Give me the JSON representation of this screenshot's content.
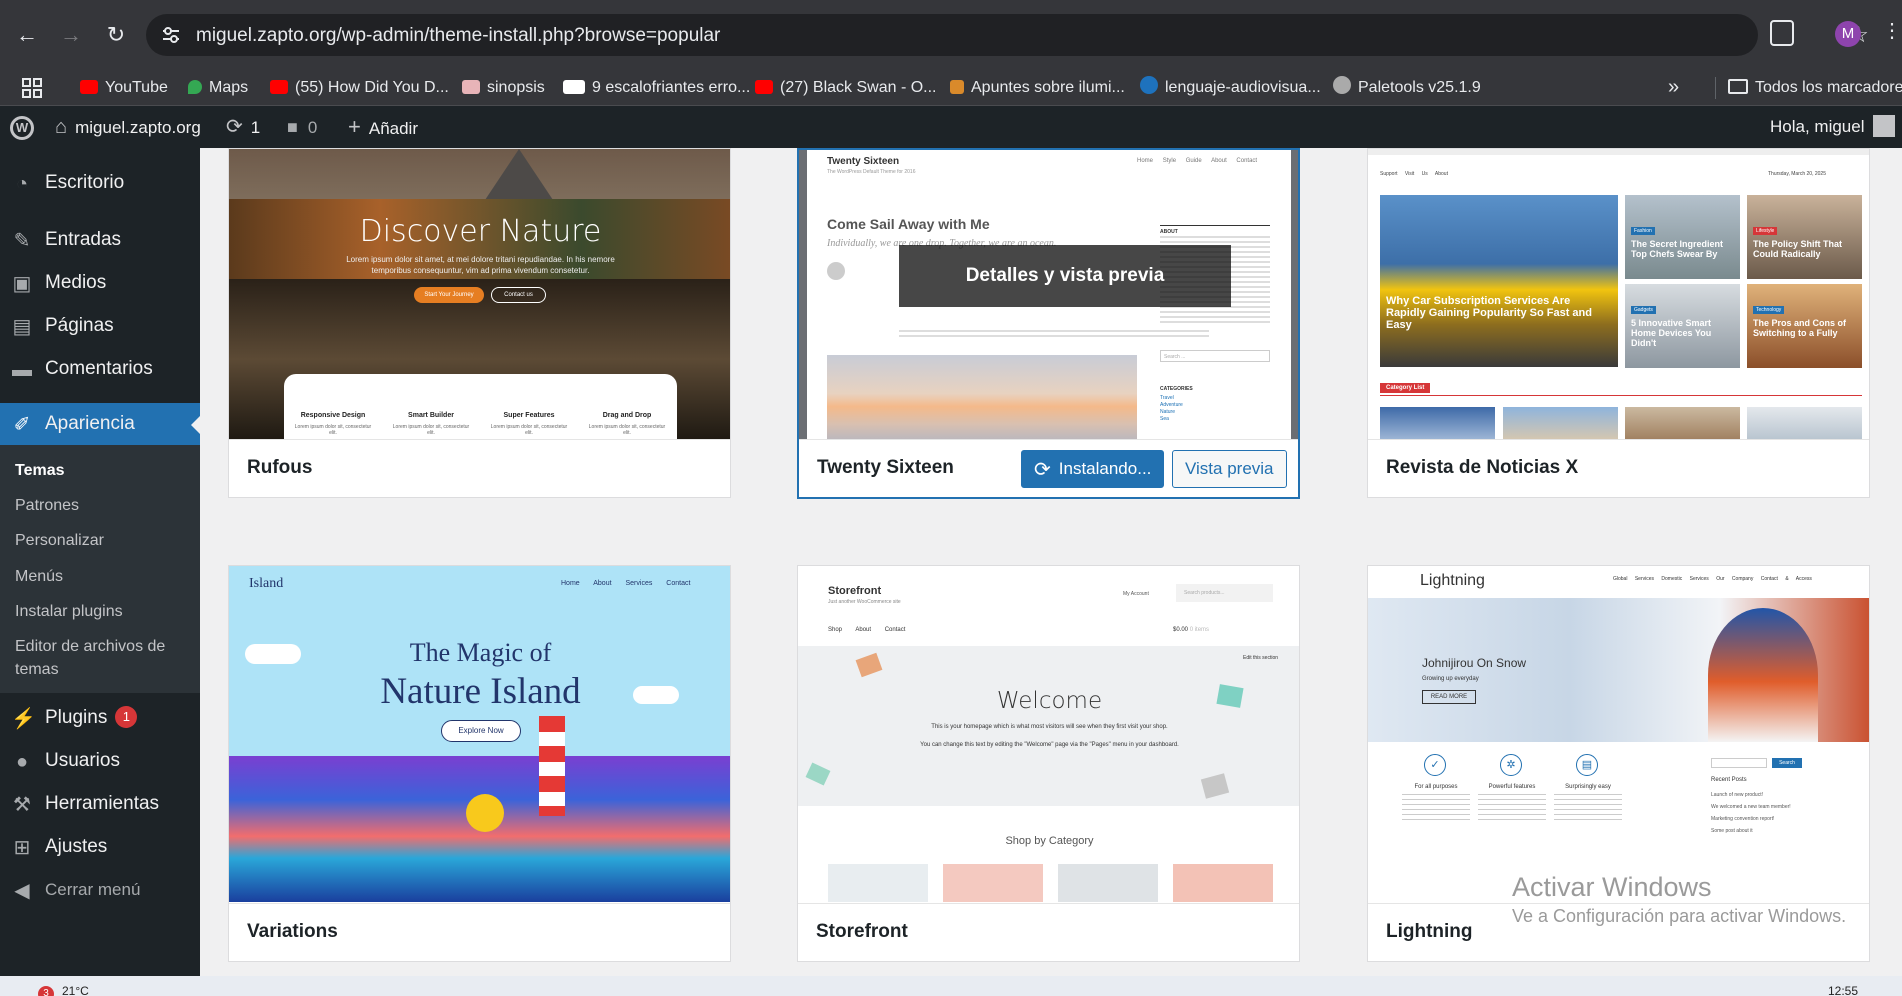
{
  "browser": {
    "url": "miguel.zapto.org/wp-admin/theme-install.php?browse=popular",
    "profile_initial": "M",
    "bookmarks": [
      {
        "label": "YouTube",
        "icon": "youtube-icon"
      },
      {
        "label": "Maps",
        "icon": "maps-icon"
      },
      {
        "label": "(55) How Did You D...",
        "icon": "youtube-icon"
      },
      {
        "label": "sinopsis",
        "icon": "bookmark-icon"
      },
      {
        "label": "9 escalofriantes erro...",
        "icon": "ed-icon"
      },
      {
        "label": "(27) Black Swan - O...",
        "icon": "youtube-icon"
      },
      {
        "label": "Apuntes sobre ilumi...",
        "icon": "person-icon"
      },
      {
        "label": "lenguaje-audiovisua...",
        "icon": "wordpress-icon"
      },
      {
        "label": "Paletools v25.1.9",
        "icon": "globe-icon"
      }
    ],
    "more_label": "»",
    "all_bookmarks": "Todos los marcadores"
  },
  "adminbar": {
    "site": "miguel.zapto.org",
    "updates": "1",
    "comments": "0",
    "new": "Añadir",
    "greeting": "Hola, miguel"
  },
  "sidebar": {
    "items": [
      {
        "label": "Escritorio",
        "icon": "dashboard-icon"
      },
      {
        "label": "Entradas",
        "icon": "pin-icon"
      },
      {
        "label": "Medios",
        "icon": "media-icon"
      },
      {
        "label": "Páginas",
        "icon": "page-icon"
      },
      {
        "label": "Comentarios",
        "icon": "comment-icon"
      },
      {
        "label": "Apariencia",
        "icon": "brush-icon"
      },
      {
        "label": "Plugins",
        "icon": "plugin-icon",
        "badge": "1"
      },
      {
        "label": "Usuarios",
        "icon": "user-icon"
      },
      {
        "label": "Herramientas",
        "icon": "wrench-icon"
      },
      {
        "label": "Ajustes",
        "icon": "settings-icon"
      },
      {
        "label": "Cerrar menú",
        "icon": "collapse-icon"
      }
    ],
    "submenu": [
      "Temas",
      "Patrones",
      "Personalizar",
      "Menús",
      "Instalar plugins",
      "Editor de archivos de temas"
    ]
  },
  "themes": {
    "rufous": {
      "name": "Rufous",
      "hero_title": "Discover Nature",
      "hero_text": "Lorem ipsum dolor sit amet, at mei dolore tritani repudiandae. In his nemore temporibus consequuntur, vim ad prima vivendum consetetur.",
      "btn1": "Start Your Journey",
      "btn2": "Contact us",
      "features": [
        "Responsive Design",
        "Smart Builder",
        "Super Features",
        "Drag and Drop"
      ],
      "feature_text": "Lorem ipsum dolor sit, consectetur elit."
    },
    "twentysixteen": {
      "name": "Twenty Sixteen",
      "site_title": "Twenty Sixteen",
      "tagline": "The WordPress Default Theme for 2016",
      "nav": [
        "Home",
        "Style Guide",
        "About",
        "Contact"
      ],
      "post_title": "Come Sail Away with Me",
      "post_excerpt": "Individually, we are one drop. Together, we are an ocean.",
      "overlay": "Detalles y vista previa",
      "installing": "Instalando...",
      "preview": "Vista previa",
      "about_label": "ABOUT",
      "categories_label": "CATEGORIES",
      "categories": [
        "Travel",
        "Adventure",
        "Nature",
        "Sea"
      ],
      "search_placeholder": "Search ..."
    },
    "revista": {
      "name": "Revista de Noticias X",
      "nav": [
        "Support",
        "Visit Us",
        "About"
      ],
      "date": "Thursday, March 20, 2025",
      "tag_list": "Category List",
      "main_headline": "Why Car Subscription Services Are Rapidly Gaining Popularity So Fast and Easy",
      "cards": [
        {
          "tag": "Fashion",
          "title": "The Secret Ingredient Top Chefs Swear By"
        },
        {
          "tag": "Lifestyle",
          "title": "The Policy Shift That Could Radically"
        },
        {
          "tag": "Gadgets",
          "title": "5 Innovative Smart Home Devices You Didn't"
        },
        {
          "tag": "Technology",
          "title": "The Pros and Cons of Switching to a Fully"
        }
      ]
    },
    "variations": {
      "name": "Variations",
      "brand": "Island",
      "nav": [
        "Home",
        "About",
        "Services",
        "Contact"
      ],
      "line1": "The Magic of",
      "line2": "Nature Island",
      "cta": "Explore Now"
    },
    "storefront": {
      "name": "Storefront",
      "brand": "Storefront",
      "tagline": "Just another WooCommerce site",
      "account": "My Account",
      "search_placeholder": "Search products...",
      "nav": [
        "Shop",
        "About",
        "Contact"
      ],
      "cart": "$0.00",
      "cart_items": "0 items",
      "edit_section": "Edit this section",
      "welcome": "Welcome",
      "welcome_text1": "This is your homepage which is what most visitors will see when they first visit your shop.",
      "welcome_text2": "You can change this text by editing the \"Welcome\" page via the \"Pages\" menu in your dashboard.",
      "shop_by": "Shop by Category"
    },
    "lightning": {
      "name": "Lightning",
      "brand": "Lightning",
      "nav": [
        "Global Services",
        "Domestic Services",
        "Our Company",
        "Contact & Access"
      ],
      "hero_title": "Johnijirou On Snow",
      "hero_sub": "Growing up everyday",
      "hero_btn": "READ MORE",
      "features": [
        "For all purposes",
        "Powerful features",
        "Surprisingly easy"
      ],
      "search_btn": "Search",
      "recent_label": "Recent Posts",
      "recent_posts": [
        "Launch of new product!",
        "We welcomed a new team member!",
        "Marketing convention report!",
        "Some post about it"
      ]
    }
  },
  "watermark": {
    "title": "Activar Windows",
    "subtitle": "Ve a Configuración para activar Windows."
  },
  "taskbar": {
    "temp": "21°C",
    "alerts": "3",
    "time": "12:55"
  }
}
